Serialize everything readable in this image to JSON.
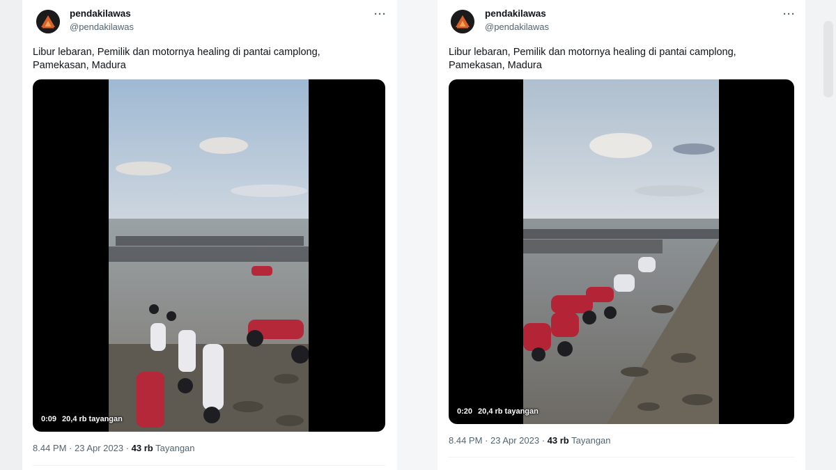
{
  "tweets": [
    {
      "author_name": "pendakilawas",
      "author_handle": "@pendakilawas",
      "text_line1": "Libur lebaran, Pemilik dan motornya healing di pantai camplong,",
      "text_line2": "Pamekasan, Madura",
      "video": {
        "time": "0:09",
        "views": "20,4 rb tayangan"
      },
      "timestamp": "8.44 PM · 23 Apr 2023 ·",
      "view_count": "43 rb",
      "view_label": "Tayangan",
      "more_icon": "more-horizontal-icon"
    },
    {
      "author_name": "pendakilawas",
      "author_handle": "@pendakilawas",
      "text_line1": "Libur lebaran, Pemilik dan motornya healing di pantai camplong,",
      "text_line2": "Pamekasan, Madura",
      "video": {
        "time": "0:20",
        "views": "20,4 rb tayangan"
      },
      "timestamp": "8.44 PM · 23 Apr 2023 ·",
      "view_count": "43 rb",
      "view_label": "Tayangan",
      "more_icon": "more-horizontal-icon"
    }
  ],
  "colors": {
    "text": "#0f1419",
    "secondary": "#536471",
    "avatar_orange": "#d9622b"
  }
}
